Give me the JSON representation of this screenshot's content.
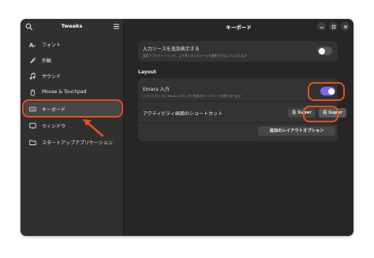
{
  "sidebar": {
    "title": "Tweaks",
    "items": [
      {
        "label": "フォント",
        "icon": "font-icon"
      },
      {
        "label": "外観",
        "icon": "appearance-icon"
      },
      {
        "label": "サウンド",
        "icon": "sound-icon"
      },
      {
        "label": "Mouse & Touchpad",
        "icon": "mouse-icon"
      },
      {
        "label": "キーボード",
        "icon": "keyboard-icon",
        "active": true
      },
      {
        "label": "ウィンドウ",
        "icon": "window-icon"
      },
      {
        "label": "スタートアップアプリケーション",
        "icon": "startup-apps-icon"
      }
    ]
  },
  "header": {
    "title": "キーボード"
  },
  "main": {
    "input_source": {
      "title": "入力ソースを追加表示する",
      "subtitle": "設定アプリケーションで、より多くの入力ソースを選択できるようになります",
      "toggle_on": false
    },
    "layout_label": "Layout",
    "emacs": {
      "title": "Emacs 入力",
      "subtitle": "ショートカットに Emacs エディター由来のキーバインドを割り当てます",
      "toggle_on": true
    },
    "activities": {
      "title": "アクティビティ画面のショートカット",
      "left_super": "左 Super",
      "right_super": "右 Super",
      "selected": "right_super"
    },
    "extra_layout_button": "追加のレイアウトオプション"
  },
  "colors": {
    "accent": "#7b68ee",
    "annotation": "#e8501e",
    "window_bg": "#262626",
    "sidebar_bg": "#303030",
    "card_bg": "#333333"
  }
}
